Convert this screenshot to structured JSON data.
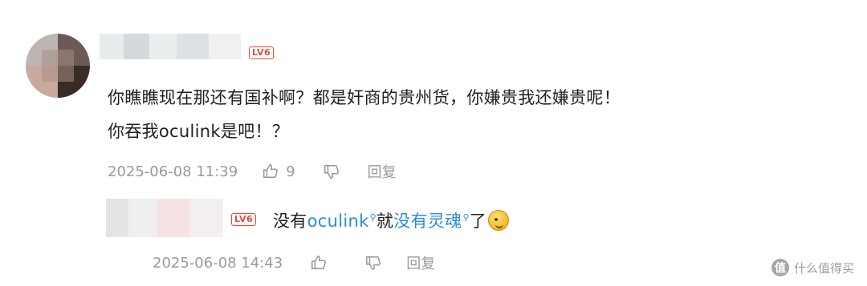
{
  "comment": {
    "level_badge": "LV6",
    "text_line1": "你瞧瞧现在那还有国补啊？都是奸商的贵州货，你嫌贵我还嫌贵呢！",
    "text_line2": "你吞我oculink是吧！？",
    "timestamp": "2025-06-08 11:39",
    "like_count": "9",
    "reply_label": "回复",
    "icons": [
      "thumb-up-icon",
      "thumb-down-icon"
    ]
  },
  "reply": {
    "level_badge": "LV6",
    "text_part1": "没有",
    "link1": "oculink",
    "text_part2": "就",
    "link2": "没有灵魂",
    "text_part3": "了",
    "timestamp": "2025-06-08 14:43",
    "reply_label": "回复",
    "icons": [
      "search-mark-icon",
      "emoji-icon",
      "thumb-up-icon",
      "thumb-down-icon"
    ]
  },
  "watermark": {
    "icon_char": "值",
    "text": "什么值得买"
  }
}
